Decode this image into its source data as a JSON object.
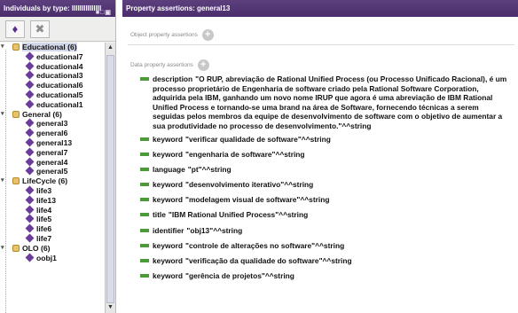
{
  "left_panel": {
    "title": "Individuals by type: IIIIIIIIIIIIIII",
    "window_buttons": "■□▣",
    "add_icon": "add-individual-icon",
    "delete_icon": "delete-individual-icon",
    "tree": [
      {
        "type": "class",
        "label": "Educational (6)",
        "selected": true
      },
      {
        "type": "individual",
        "label": "educational7"
      },
      {
        "type": "individual",
        "label": "educational4"
      },
      {
        "type": "individual",
        "label": "educational3"
      },
      {
        "type": "individual",
        "label": "educational6"
      },
      {
        "type": "individual",
        "label": "educational5"
      },
      {
        "type": "individual",
        "label": "educational1"
      },
      {
        "type": "class",
        "label": "General (6)"
      },
      {
        "type": "individual",
        "label": "general3"
      },
      {
        "type": "individual",
        "label": "general6"
      },
      {
        "type": "individual",
        "label": "general13"
      },
      {
        "type": "individual",
        "label": "general7"
      },
      {
        "type": "individual",
        "label": "general4"
      },
      {
        "type": "individual",
        "label": "general5"
      },
      {
        "type": "class",
        "label": "LifeCycle (6)"
      },
      {
        "type": "individual",
        "label": "life3"
      },
      {
        "type": "individual",
        "label": "life13"
      },
      {
        "type": "individual",
        "label": "life4"
      },
      {
        "type": "individual",
        "label": "life5"
      },
      {
        "type": "individual",
        "label": "life6"
      },
      {
        "type": "individual",
        "label": "life7"
      },
      {
        "type": "class",
        "label": "OLO (6)"
      },
      {
        "type": "individual",
        "label": "oobj1"
      }
    ]
  },
  "right_panel": {
    "title": "Property assertions: general13",
    "object_section_label": "Object property assertions",
    "data_section_label": "Data property assertions",
    "plus_glyph": "+",
    "assertions": [
      {
        "property": "description",
        "value": "\"O RUP, abreviação de Rational Unified Process (ou Processo Unificado Racional), é um processo proprietário de Engenharia de software criado pela Rational Software Corporation, adquirida pela IBM, ganhando um novo nome IRUP que agora é uma abreviação de IBM Rational Unified Process e tornando-se uma brand na área de Software, fornecendo técnicas a serem seguidas pelos membros da equipe de desenvolvimento de software com o objetivo de aumentar a sua produtividade no processo de desenvolvimento.\"^^string"
      },
      {
        "property": "keyword",
        "value": "\"verificar qualidade de software\"^^string"
      },
      {
        "property": "keyword",
        "value": "\"engenharia de software\"^^string"
      },
      {
        "property": "language",
        "value": "\"pt\"^^string"
      },
      {
        "property": "keyword",
        "value": "\"desenvolvimento iterativo\"^^string"
      },
      {
        "property": "keyword",
        "value": "\"modelagem visual de software\"^^string"
      },
      {
        "property": "title",
        "value": "\"IBM Rational Unified Process\"^^string"
      },
      {
        "property": "identifier",
        "value": "\"obj13\"^^string"
      },
      {
        "property": "keyword",
        "value": "\"controle de alterações no software\"^^string"
      },
      {
        "property": "keyword",
        "value": "\"verificação da qualidade do software\"^^string"
      },
      {
        "property": "keyword",
        "value": "\"gerência de projetos\"^^string"
      }
    ]
  },
  "scrollbar": {
    "up": "▲",
    "down": "▼"
  },
  "colors": {
    "titlebar": "#4a2d6a",
    "assertion_bar": "#4d9a3a",
    "class_icon": "#e7c26b",
    "individual_icon": "#6a3c9c"
  }
}
